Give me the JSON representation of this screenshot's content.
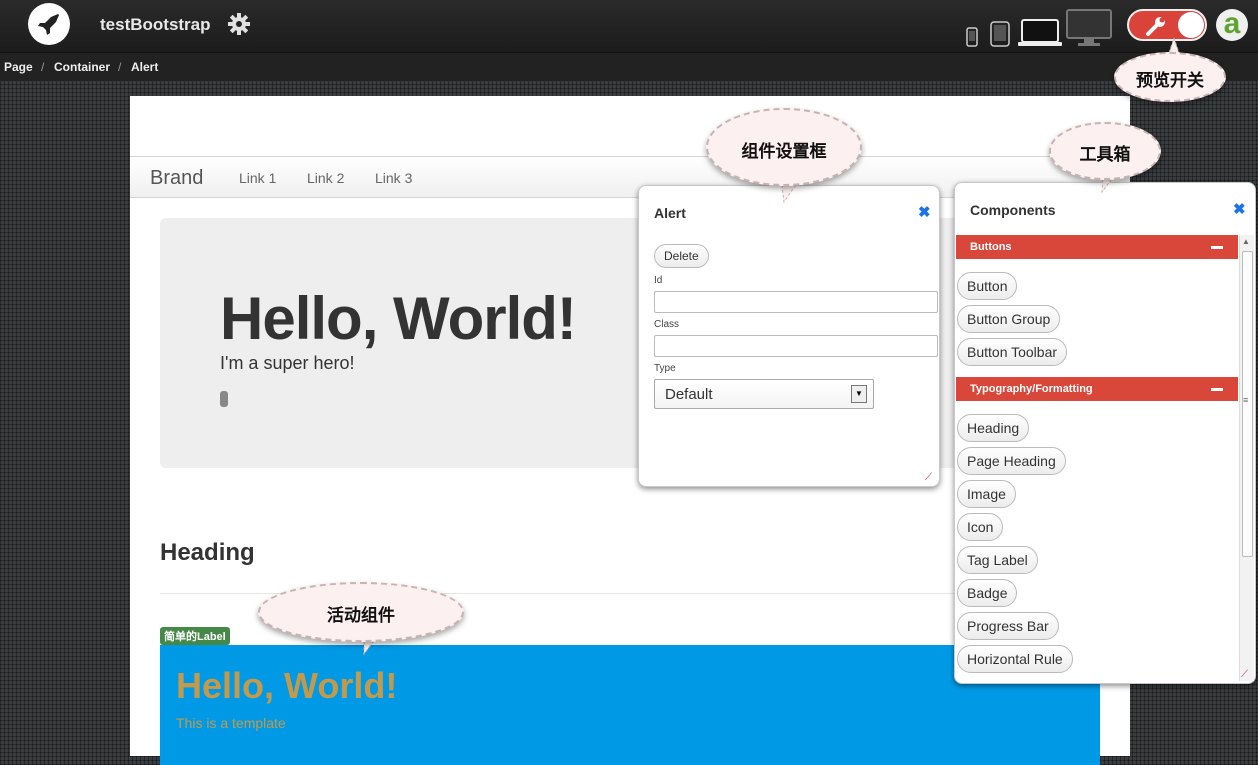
{
  "app": {
    "title": "testBootstrap"
  },
  "breadcrumb": [
    "Page",
    "Container",
    "Alert"
  ],
  "breadcrumb_sep": "/",
  "canvas": {
    "navbar": {
      "brand": "Brand",
      "links": [
        "Link 1",
        "Link 2",
        "Link 3"
      ]
    },
    "hero": {
      "title": "Hello, World!",
      "subtitle": "I'm a super hero!"
    },
    "heading": "Heading",
    "tag_label": "简单的Label",
    "active": {
      "title": "Hello, World!",
      "subtitle": "This is a template"
    }
  },
  "settings_panel": {
    "title": "Alert",
    "close_glyph": "✖",
    "delete_label": "Delete",
    "id_label": "Id",
    "class_label": "Class",
    "type_label": "Type",
    "type_value": "Default"
  },
  "components_panel": {
    "title": "Components",
    "close_glyph": "✖",
    "sections": [
      {
        "name": "Buttons",
        "items": [
          "Button",
          "Button Group",
          "Button Toolbar"
        ]
      },
      {
        "name": "Typography/Formatting",
        "items": [
          "Heading",
          "Page Heading",
          "Image",
          "Icon",
          "Tag Label",
          "Badge",
          "Progress Bar",
          "Horizontal Rule"
        ]
      }
    ]
  },
  "callouts": {
    "preview_toggle": "预览开关",
    "settings_box": "组件设置框",
    "toolbox": "工具箱",
    "active_component": "活动组件"
  },
  "colors": {
    "section_bar": "#d9473b",
    "toggle_bg": "#d9433a",
    "active_component_bg": "#0099e6",
    "active_text": "#c49a4a",
    "tag_label_bg": "#468847",
    "close_icon": "#1a73e8"
  },
  "icons": [
    "rocket-icon",
    "gear-icon",
    "phone-icon",
    "tablet-icon",
    "laptop-icon",
    "desktop-icon",
    "wrench-icon",
    "avatar-icon",
    "close-icon",
    "minus-icon",
    "chevron-down-icon",
    "resize-handle-icon"
  ],
  "avatar_glyph": "a"
}
